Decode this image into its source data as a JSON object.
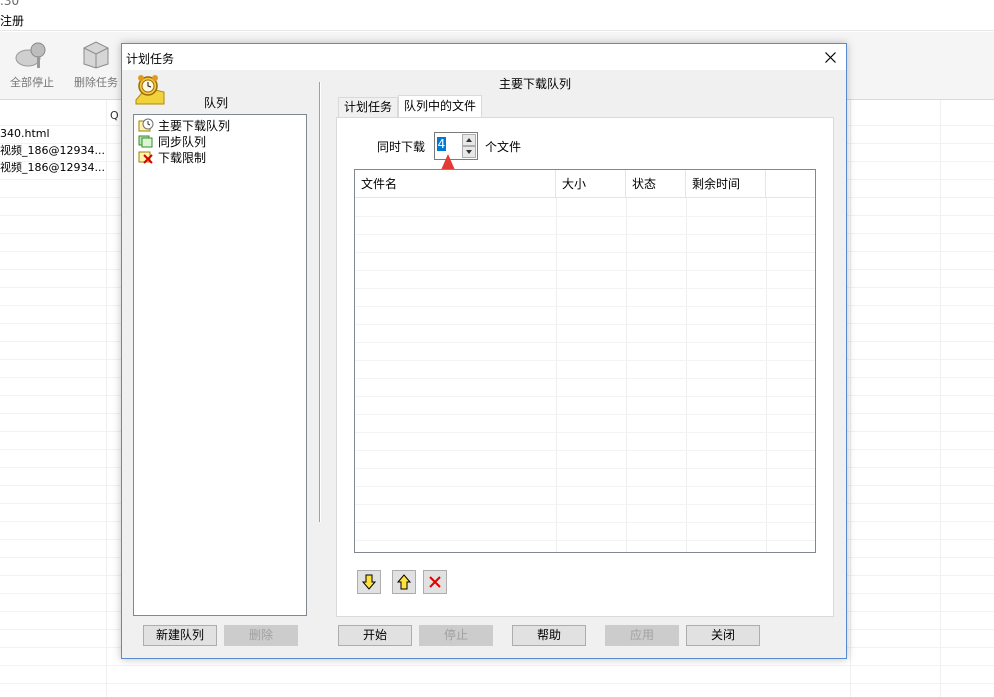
{
  "background": {
    "title_fragment": ".30",
    "menu_item": "注册",
    "toolbar": [
      {
        "label": "全部停止",
        "icon": "stop-all-icon"
      },
      {
        "label": "删除任务",
        "icon": "delete-task-icon"
      }
    ],
    "column_fragment": "Q",
    "list_items": [
      "340.html",
      "视频_186@12934...",
      "视频_186@12934..."
    ]
  },
  "dialog": {
    "title": "计划任务",
    "left_pane": {
      "header": "队列",
      "items": [
        {
          "label": "主要下载队列",
          "icon": "main-queue-icon"
        },
        {
          "label": "同步队列",
          "icon": "sync-queue-icon"
        },
        {
          "label": "下载限制",
          "icon": "download-limit-icon"
        }
      ],
      "new_queue_button": "新建队列",
      "delete_button": "删除"
    },
    "right_pane": {
      "queue_title": "主要下载队列",
      "tabs": [
        {
          "label": "计划任务",
          "active": false
        },
        {
          "label": "队列中的文件",
          "active": true
        }
      ],
      "concurrent_label": "同时下载",
      "concurrent_value": "4",
      "concurrent_unit": "个文件",
      "table_columns": [
        "文件名",
        "大小",
        "状态",
        "剩余时间"
      ],
      "move_down_icon": "arrow-down-icon",
      "move_up_icon": "arrow-up-icon",
      "remove_icon": "remove-x-icon"
    },
    "buttons": {
      "start": "开始",
      "stop": "停止",
      "help": "帮助",
      "apply": "应用",
      "close": "关闭"
    }
  },
  "colors": {
    "accent": "#0078d7",
    "annotation": "#e53935",
    "dialog_border": "#5a8bd0"
  }
}
